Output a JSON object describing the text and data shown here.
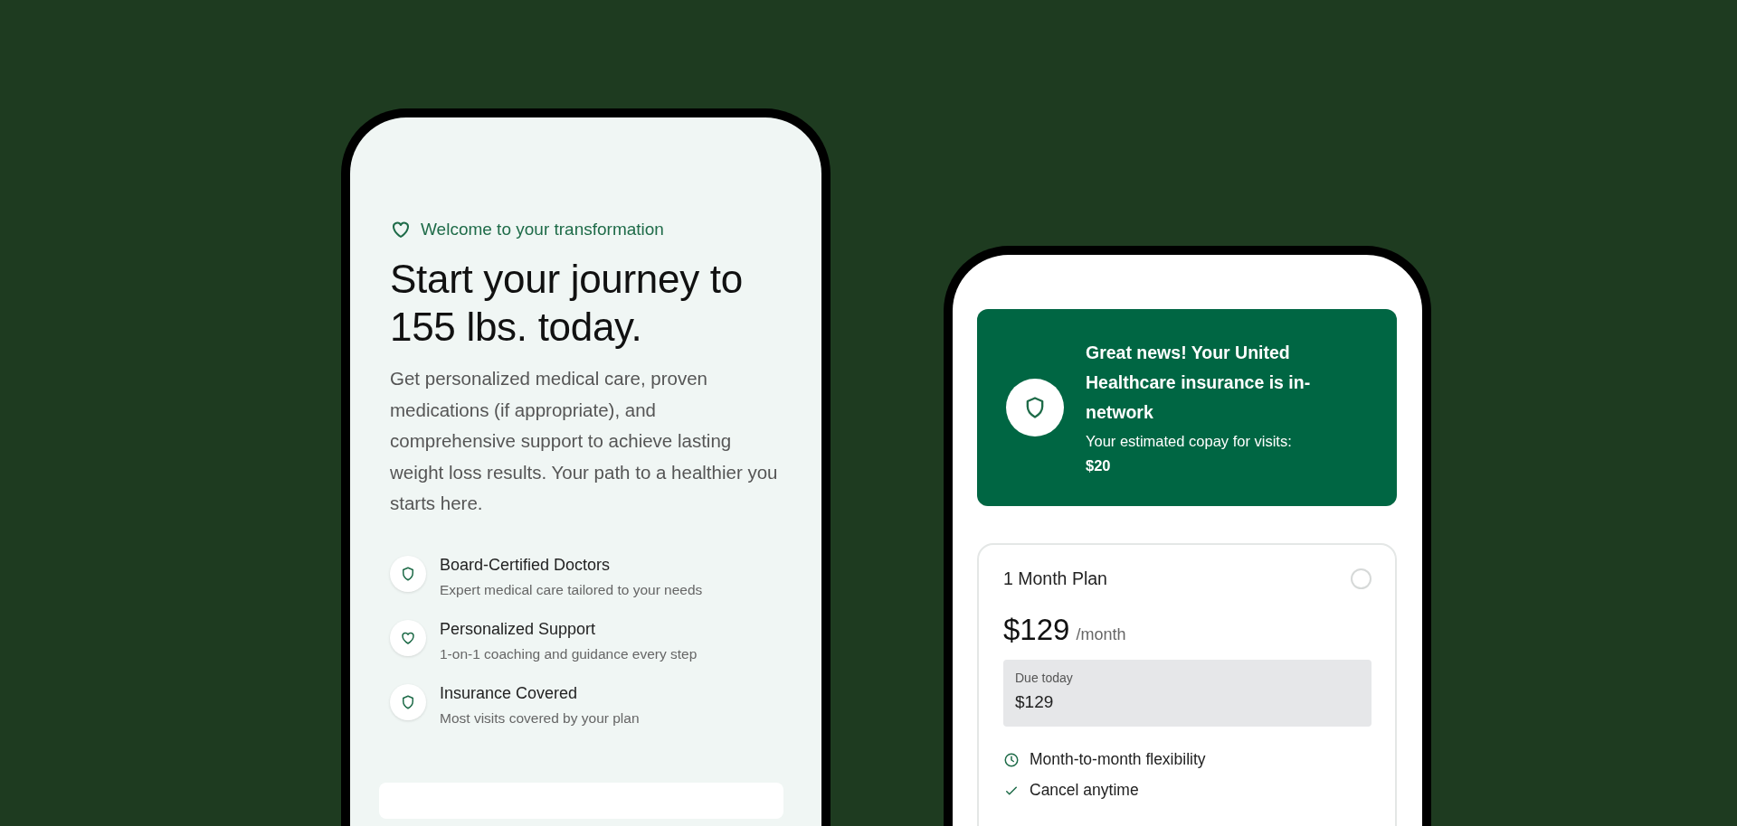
{
  "welcome_phone": {
    "eyebrow": "Welcome to your transformation",
    "headline": "Start your journey to 155 lbs. today.",
    "intro": "Get personalized medical care, proven medications (if appropriate), and comprehensive support to achieve lasting weight loss results. Your path to a healthier you starts here.",
    "features": [
      {
        "kind": "shield",
        "title": "Board-Certified Doctors",
        "subtitle": "Expert medical care tailored to your needs"
      },
      {
        "kind": "heart",
        "title": "Personalized Support",
        "subtitle": "1-on-1 coaching and guidance every step"
      },
      {
        "kind": "shield",
        "title": "Insurance Covered",
        "subtitle": "Most visits covered by your plan"
      }
    ]
  },
  "plan_phone": {
    "banner": {
      "title": "Great news! Your United Healthcare insurance is in-network",
      "subtitle": "Your estimated copay for visits:",
      "copay": "$20"
    },
    "plan": {
      "name": "1 Month Plan",
      "selected": false,
      "price": "$129",
      "period": "/month",
      "due_label": "Due today",
      "due_amount": "$129",
      "perks": [
        {
          "kind": "clock",
          "text": "Month-to-month flexibility"
        },
        {
          "kind": "check",
          "text": "Cancel anytime"
        }
      ]
    }
  }
}
